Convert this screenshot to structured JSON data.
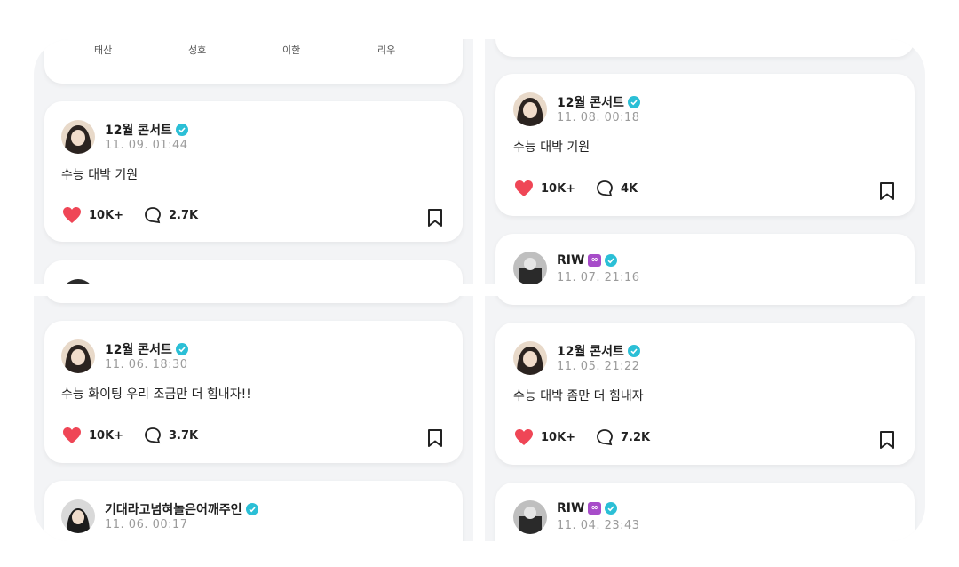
{
  "members": [
    "태산",
    "성호",
    "이한",
    "리우"
  ],
  "posts": {
    "tl1": {
      "name": "12월 콘서트",
      "time": "11. 09. 01:44",
      "text": "수능 대박 기원",
      "likes": "10K+",
      "comments": "2.7K"
    },
    "tr0": {
      "name": "12월 콘서트",
      "time": "11. 08. 00:18",
      "text": "수능 대박 기원",
      "likes": "10K+",
      "comments": "4K"
    },
    "tr1": {
      "name": "RIW",
      "badge": "∞",
      "time": "11. 07. 21:16"
    },
    "bl0": {
      "name": "12월 콘서트",
      "time": "11. 06. 18:30",
      "text": "수능 화이팅 우리 조금만 더 힘내자!!",
      "likes": "10K+",
      "comments": "3.7K"
    },
    "bl1": {
      "name": "기대라고넘혀놀은어깨주인",
      "time": "11. 06. 00:17"
    },
    "br0": {
      "name": "12월 콘서트",
      "time": "11. 05. 21:22",
      "text": "수능 대박 좀만 더 힘내자",
      "likes": "10K+",
      "comments": "7.2K"
    },
    "br1": {
      "name": "RIW",
      "badge": "∞",
      "time": "11. 04. 23:43"
    }
  },
  "colors": {
    "heart": "#ef4656",
    "verified": "#2bbfd6",
    "badge": "#a74cc9"
  },
  "icons": [
    "heart-icon",
    "comment-icon",
    "bookmark-icon",
    "verified-icon"
  ]
}
